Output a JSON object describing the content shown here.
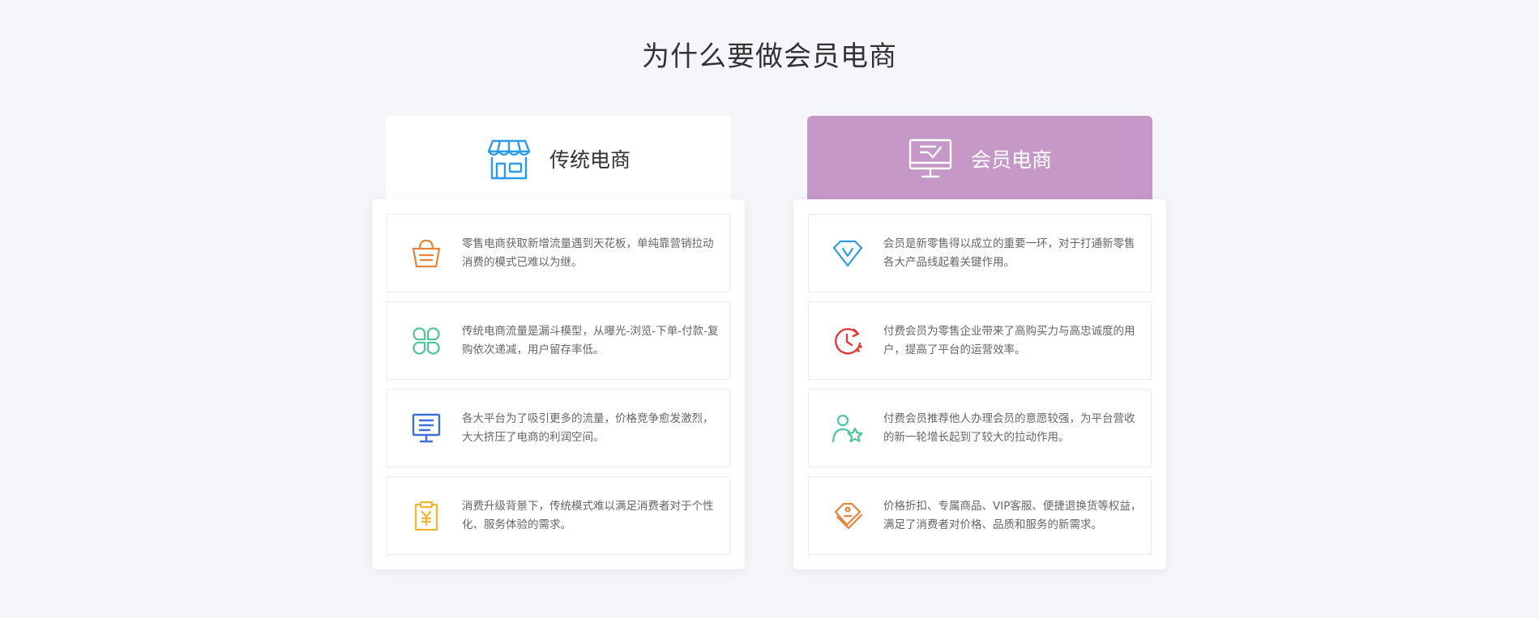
{
  "page": {
    "title": "为什么要做会员电商"
  },
  "left": {
    "title": "传统电商",
    "header_icon": "storefront-icon",
    "accent": "#2f9be8",
    "items": [
      {
        "icon": "shopping-basket-icon",
        "color": "#e8833a",
        "text": "零售电商获取新增流量遇到天花板，单纯靠营销拉动消费的模式已难以为继。"
      },
      {
        "icon": "clover-icon",
        "color": "#4fc59a",
        "text": "传统电商流量是漏斗模型，从曝光-浏览-下单-付款-复购依次递减，用户留存率低。"
      },
      {
        "icon": "billboard-icon",
        "color": "#3b6fd9",
        "text": "各大平台为了吸引更多的流量，价格竞争愈发激烈，大大挤压了电商的利润空间。"
      },
      {
        "icon": "yuan-clipboard-icon",
        "color": "#f2b431",
        "text": "消费升级背景下，传统模式难以满足消费者对于个性化、服务体验的需求。"
      }
    ]
  },
  "right": {
    "title": "会员电商",
    "header_icon": "monitor-check-icon",
    "header_bg": "#c598c8",
    "items": [
      {
        "icon": "diamond-icon",
        "color": "#2f9be8",
        "text": "会员是新零售得以成立的重要一环，对于打通新零售各大产品线起着关键作用。"
      },
      {
        "icon": "clock-refresh-icon",
        "color": "#e23b3b",
        "text": "付费会员为零售企业带来了高购买力与高忠诚度的用户，提高了平台的运营效率。"
      },
      {
        "icon": "user-star-icon",
        "color": "#4fc59a",
        "text": "付费会员推荐他人办理会员的意愿较强，为平台营收的新一轮增长起到了较大的拉动作用。"
      },
      {
        "icon": "price-tag-icon",
        "color": "#e8833a",
        "text": "价格折扣、专属商品、VIP客服、便捷退换货等权益，满足了消费者对价格、品质和服务的新需求。"
      }
    ]
  }
}
